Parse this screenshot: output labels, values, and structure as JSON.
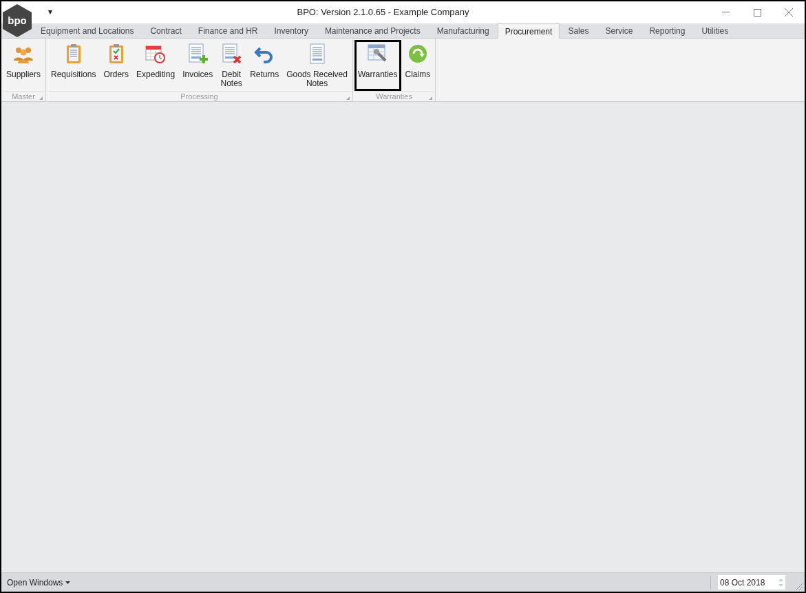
{
  "window": {
    "title": "BPO: Version 2.1.0.65 - Example Company",
    "logo": "bpo",
    "menu_arrow": "▾"
  },
  "tabs": [
    {
      "label": "Equipment and Locations",
      "selected": false
    },
    {
      "label": "Contract",
      "selected": false
    },
    {
      "label": "Finance and HR",
      "selected": false
    },
    {
      "label": "Inventory",
      "selected": false
    },
    {
      "label": "Maintenance and Projects",
      "selected": false
    },
    {
      "label": "Manufacturing",
      "selected": false
    },
    {
      "label": "Procurement",
      "selected": true
    },
    {
      "label": "Sales",
      "selected": false
    },
    {
      "label": "Service",
      "selected": false
    },
    {
      "label": "Reporting",
      "selected": false
    },
    {
      "label": "Utilities",
      "selected": false
    }
  ],
  "ribbon_groups": [
    {
      "label": "Master",
      "buttons": [
        {
          "kind": "people",
          "lines": [
            "Suppliers"
          ],
          "selected": false
        }
      ]
    },
    {
      "label": "Processing",
      "buttons": [
        {
          "kind": "clipboard",
          "lines": [
            "Requisitions"
          ],
          "selected": false
        },
        {
          "kind": "checklist",
          "lines": [
            "Orders"
          ],
          "selected": false
        },
        {
          "kind": "calendar",
          "lines": [
            "Expediting"
          ],
          "selected": false
        },
        {
          "kind": "doc-plus",
          "lines": [
            "Invoices"
          ],
          "selected": false
        },
        {
          "kind": "doc-x",
          "lines": [
            "Debit",
            "Notes"
          ],
          "selected": false
        },
        {
          "kind": "undo",
          "lines": [
            "Returns"
          ],
          "selected": false
        },
        {
          "kind": "doc",
          "lines": [
            "Goods Received",
            "Notes"
          ],
          "selected": false
        }
      ]
    },
    {
      "label": "Warranties",
      "buttons": [
        {
          "kind": "wrench",
          "lines": [
            "Warranties"
          ],
          "selected": true
        },
        {
          "kind": "refresh",
          "lines": [
            "Claims"
          ],
          "selected": false
        }
      ]
    }
  ],
  "status_bar": {
    "open_windows": "Open Windows",
    "date": "08 Oct 2018"
  }
}
